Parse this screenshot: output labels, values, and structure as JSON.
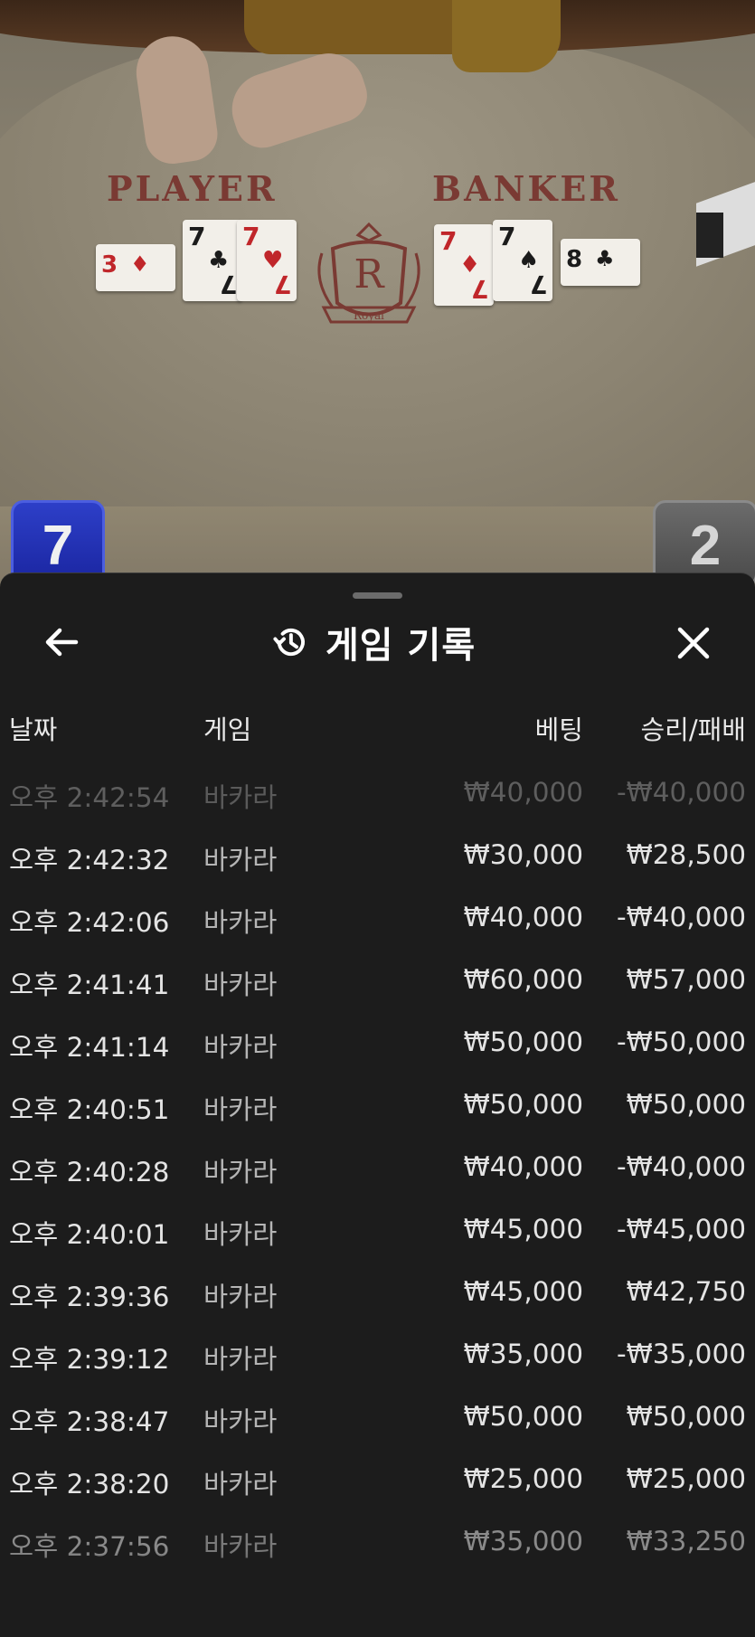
{
  "game_view": {
    "player_label": "PLAYER",
    "banker_label": "BANKER",
    "player_score": "7",
    "banker_score": "2",
    "player_cards": [
      {
        "rank": "3",
        "suit": "♦",
        "color": "red"
      },
      {
        "rank": "7",
        "suit": "♣",
        "color": "black"
      },
      {
        "rank": "7",
        "suit": "♥",
        "color": "red"
      }
    ],
    "banker_cards": [
      {
        "rank": "7",
        "suit": "♦",
        "color": "red"
      },
      {
        "rank": "7",
        "suit": "♠",
        "color": "black"
      },
      {
        "rank": "8",
        "suit": "♣",
        "color": "black"
      }
    ],
    "crest_letter": "R",
    "crest_banner": "Royal"
  },
  "panel": {
    "title": "게임 기록",
    "back_icon": "arrow-left-icon",
    "history_icon": "history-icon",
    "close_icon": "close-icon",
    "columns": {
      "date": "날짜",
      "game": "게임",
      "bet": "베팅",
      "result": "승리/패배"
    },
    "rows": [
      {
        "time": "오후 2:42:54",
        "game": "바카라",
        "bet": "₩40,000",
        "result": "-₩40,000"
      },
      {
        "time": "오후 2:42:32",
        "game": "바카라",
        "bet": "₩30,000",
        "result": "₩28,500"
      },
      {
        "time": "오후 2:42:06",
        "game": "바카라",
        "bet": "₩40,000",
        "result": "-₩40,000"
      },
      {
        "time": "오후 2:41:41",
        "game": "바카라",
        "bet": "₩60,000",
        "result": "₩57,000"
      },
      {
        "time": "오후 2:41:14",
        "game": "바카라",
        "bet": "₩50,000",
        "result": "-₩50,000"
      },
      {
        "time": "오후 2:40:51",
        "game": "바카라",
        "bet": "₩50,000",
        "result": "₩50,000"
      },
      {
        "time": "오후 2:40:28",
        "game": "바카라",
        "bet": "₩40,000",
        "result": "-₩40,000"
      },
      {
        "time": "오후 2:40:01",
        "game": "바카라",
        "bet": "₩45,000",
        "result": "-₩45,000"
      },
      {
        "time": "오후 2:39:36",
        "game": "바카라",
        "bet": "₩45,000",
        "result": "₩42,750"
      },
      {
        "time": "오후 2:39:12",
        "game": "바카라",
        "bet": "₩35,000",
        "result": "-₩35,000"
      },
      {
        "time": "오후 2:38:47",
        "game": "바카라",
        "bet": "₩50,000",
        "result": "₩50,000"
      },
      {
        "time": "오후 2:38:20",
        "game": "바카라",
        "bet": "₩25,000",
        "result": "₩25,000"
      },
      {
        "time": "오후 2:37:56",
        "game": "바카라",
        "bet": "₩35,000",
        "result": "₩33,250"
      }
    ]
  }
}
